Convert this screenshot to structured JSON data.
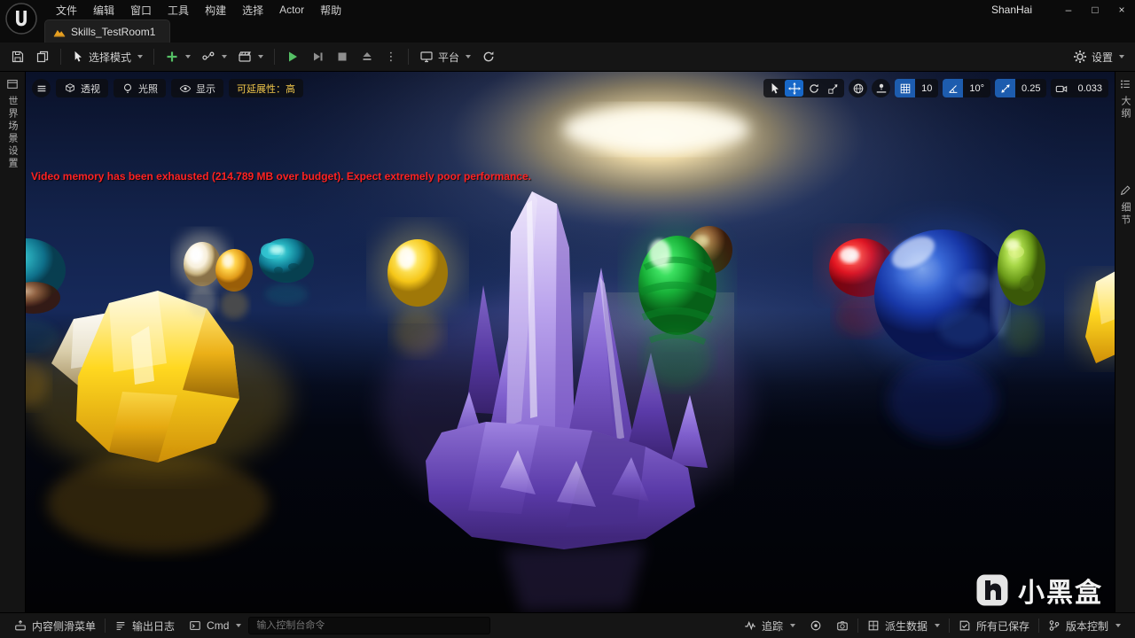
{
  "menu": {
    "items": [
      "文件",
      "编辑",
      "窗口",
      "工具",
      "构建",
      "选择",
      "Actor",
      "帮助"
    ],
    "session": "ShanHai"
  },
  "icons": {
    "minimize": "–",
    "maximize": "□",
    "close": "×",
    "kebab": "⋮"
  },
  "tab": {
    "label": "Skills_TestRoom1"
  },
  "toolbar": {
    "select_mode": "选择模式",
    "platform": "平台",
    "settings": "设置"
  },
  "viewport": {
    "perspective": "透视",
    "lit": "光照",
    "show": "显示",
    "scalability": "可延展性：高",
    "warning": "Video memory has been exhausted (214.789 MB over budget). Expect extremely poor performance.",
    "snap": {
      "grid": "10",
      "angle": "10°",
      "scale": "0.25",
      "camera_speed": "0.033"
    }
  },
  "panels": {
    "left_tab": "世界场景设置",
    "right_tabs": [
      "大纲",
      "细节"
    ]
  },
  "status": {
    "content_drawer": "内容侧滑菜单",
    "output_log": "输出日志",
    "cmd": "Cmd",
    "console_placeholder": "输入控制台命令",
    "trace": "追踪",
    "derived_data": "派生数据",
    "saved": "所有已保存",
    "version_control": "版本控制"
  },
  "watermark": {
    "text": "小黑盒"
  },
  "scene": {
    "description": "UE5 perspective viewport: crystal clusters and gem eggs on a dark reflective floor lit by one bright overhead light",
    "objects": [
      {
        "name": "yellow-crystal-cluster",
        "color": "#ffd820"
      },
      {
        "name": "white-crystal-chunk",
        "color": "#e8e0c8"
      },
      {
        "name": "white-egg",
        "color": "#f8f0dc"
      },
      {
        "name": "golden-egg",
        "color": "#ffd24a"
      },
      {
        "name": "teal-rough-stone",
        "color": "#2ab8c4"
      },
      {
        "name": "yellow-egg",
        "color": "#ffe96a"
      },
      {
        "name": "purple-crystal-cluster",
        "color": "#a58ae0"
      },
      {
        "name": "green-spiral-egg",
        "color": "#2cd050"
      },
      {
        "name": "brown-stone",
        "color": "#a86840"
      },
      {
        "name": "red-egg",
        "color": "#e01420"
      },
      {
        "name": "blue-gem",
        "color": "#2a50c0"
      },
      {
        "name": "lime-rough-stone",
        "color": "#a8d848"
      },
      {
        "name": "yellow-gem-right",
        "color": "#ffd820"
      }
    ]
  }
}
